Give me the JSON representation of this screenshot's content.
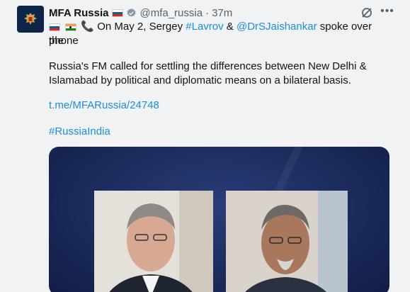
{
  "account": {
    "name": "MFA Russia",
    "handle": "@mfa_russia",
    "separator": "·",
    "time": "37m"
  },
  "post": {
    "line1_prefix": "On May 2, Sergey ",
    "mention_lavrov": "#Lavrov",
    "amp": " & ",
    "mention_jaishankar": "@DrSJaishankar",
    "line1_suffix": " spoke over the",
    "line2": "phone",
    "paragraph": "Russia's FM called for settling the differences between New Delhi & Islamabad by political and diplomatic means on a bilateral basis.",
    "url": "t.me/MFARussia/24748",
    "hashtag": "#RussiaIndia"
  },
  "colors": {
    "link": "#1d8ed6",
    "media_bg": "#1c2b5c"
  },
  "icons": [
    "russia-emblem-icon",
    "verified-badge-icon",
    "grok-icon",
    "more-icon",
    "phone-icon"
  ]
}
